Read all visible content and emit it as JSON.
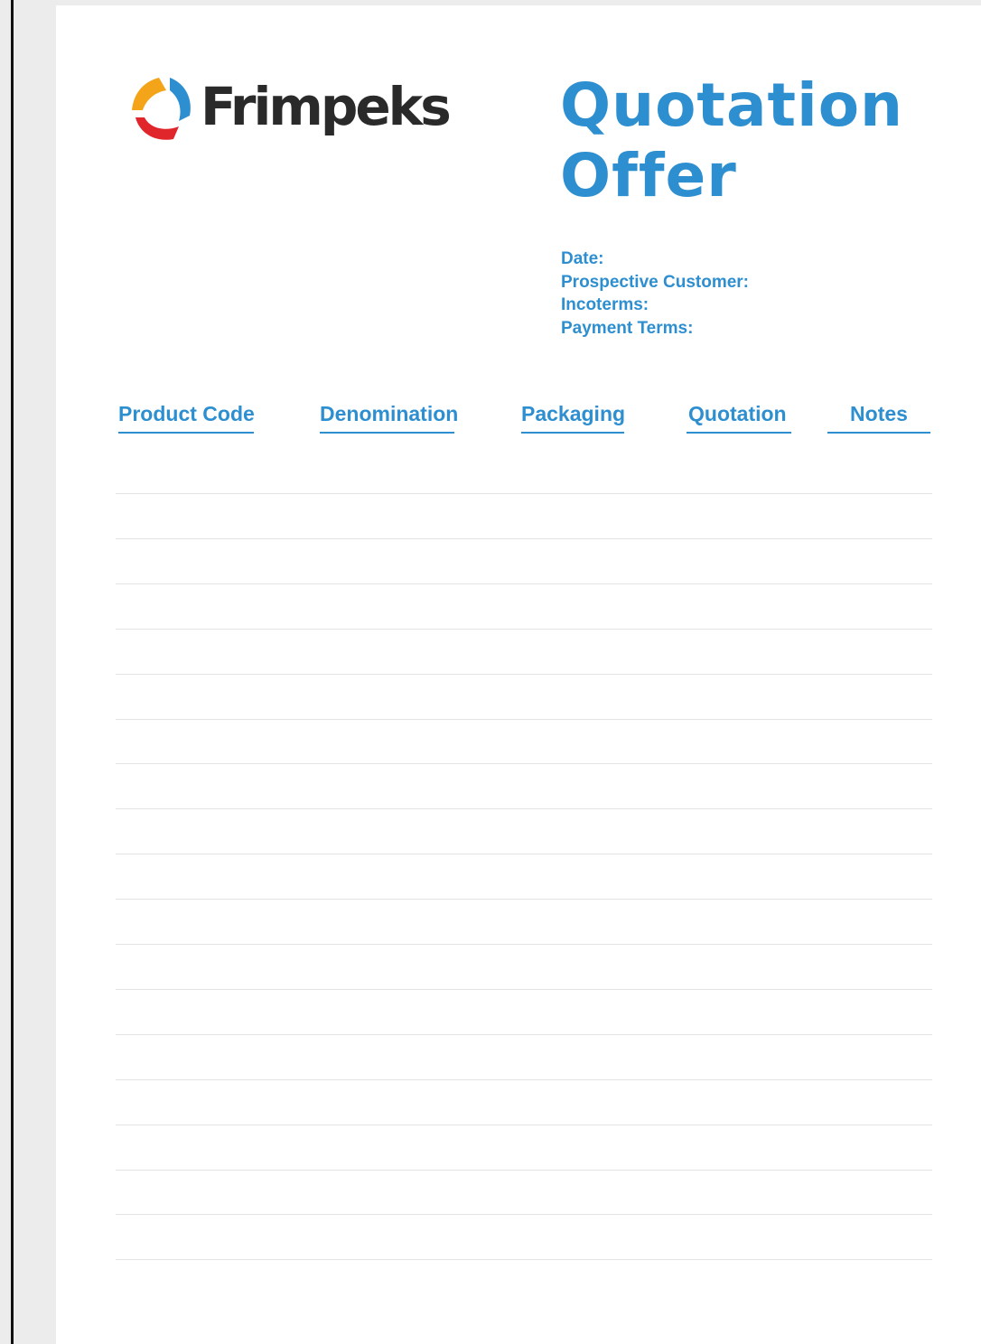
{
  "brand": {
    "name": "Frimpeks",
    "icon": "tricolor-swirl-logo-icon",
    "colors": {
      "orange": "#f4a418",
      "blue": "#2d8fd0",
      "red": "#e0262b",
      "dark": "#2a2a2a"
    }
  },
  "title": {
    "line1": "Quotation",
    "line2": "Offer"
  },
  "meta": {
    "date_label": "Date:",
    "customer_label": "Prospective Customer:",
    "incoterms_label": "Incoterms:",
    "payment_label": "Payment Terms:"
  },
  "table": {
    "columns": [
      "Product Code",
      "Denomination",
      "Packaging",
      "Quotation",
      "Notes"
    ],
    "rows": 18
  },
  "accent_color": "#2d8fd0"
}
